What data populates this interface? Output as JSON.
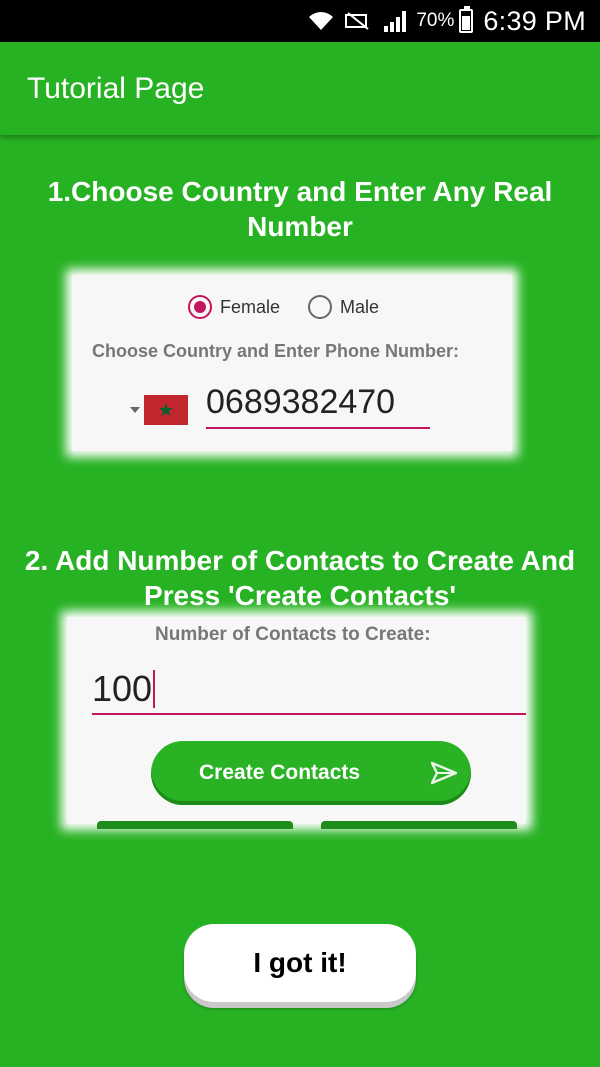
{
  "status_bar": {
    "battery_pct": "70%",
    "time": "6:39 PM",
    "icons": [
      "wifi-icon",
      "no-sim-icon",
      "signal-icon",
      "battery-icon"
    ]
  },
  "app_bar": {
    "title": "Tutorial Page"
  },
  "step1": {
    "title": "1.Choose Country and Enter Any Real Number",
    "gender_options": [
      {
        "label": "Female",
        "selected": true
      },
      {
        "label": "Male",
        "selected": false
      }
    ],
    "hint": "Choose Country and Enter Phone Number:",
    "phone_number": "0689382470",
    "flag": "morocco-flag-icon"
  },
  "step2": {
    "title": "2. Add Number of Contacts to Create And Press 'Create Contacts'",
    "label": "Number of Contacts to Create:",
    "value": "100",
    "button_label": "Create Contacts"
  },
  "got_it_label": "I got it!",
  "colors": {
    "background": "#27b223",
    "accent": "#c2185b",
    "button_green": "#29b224"
  }
}
